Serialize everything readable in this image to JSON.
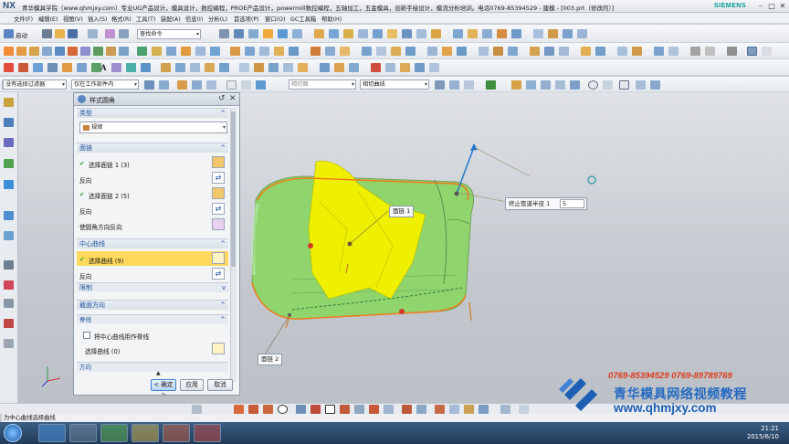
{
  "window": {
    "app_logo": "NX",
    "title": "青华模具学院（www.qhmjxy.com）专业UG产品设计，模具设计，数控编程，PROE产品设计，powermill数控编程，五轴加工，五金模具，创新手绘设计，模流分析培训。电话0769-85394529 - 建模 - [003.prt（修改的）]",
    "brand": "SIEMENS",
    "controls": [
      "–",
      "□",
      "✕"
    ]
  },
  "menubar": {
    "items": [
      "文件(F)",
      "编辑(E)",
      "视图(V)",
      "插入(S)",
      "格式(R)",
      "工具(T)",
      "装配(A)",
      "信息(I)",
      "分析(L)",
      "首选项(P)",
      "窗口(O)",
      "GC工具箱",
      "帮助(H)"
    ]
  },
  "toolbar1": {
    "start_label": "启动",
    "command_search_placeholder": "查找命令"
  },
  "selection_bar": {
    "filter_value": "没有选择过滤器",
    "scope_value": "仅在工作部件内",
    "dd3_value": "相切面",
    "dd4_value": "相切曲线"
  },
  "dialog": {
    "title": "样式圆角",
    "type_section": "类型",
    "type_value": "规律",
    "rails_section": "面链",
    "rail1_label": "选择面链 1 (3)",
    "reverse1": "反向",
    "rail2_label": "选择面链 2 (5)",
    "reverse2": "反向",
    "flip_fillet_label": "使圆角方向反向",
    "spine_section": "中心曲线",
    "spine_select_label": "选择曲线 (9)",
    "reverse3": "反向",
    "limits_label": "限制",
    "section_orient": "截面方向",
    "spine_sub": "脊线",
    "use_spine_checkbox": "将中心曲线用作脊线",
    "spine_curve_label": "选择曲线 (0)",
    "direction_label": "方向",
    "ok": "< 确定 >",
    "apply": "应用",
    "cancel": "取消"
  },
  "viewport": {
    "radius_label": "终止管道半径 1",
    "radius_value": "5",
    "tag1": "面链 1",
    "tag2": "面链 2"
  },
  "status": {
    "prompt": "为中心曲线选择曲线"
  },
  "taskbar": {
    "time": "21:21",
    "date": "2015/6/10"
  },
  "promo": {
    "phones": "0769-85394529  0769-89789769",
    "brand": "青华模具网络视频教程",
    "url": "www.qhmjxy.com"
  },
  "colors": {
    "model_green": "#8fd46c",
    "fillet_yellow": "#eef000",
    "edge_orange": "#f07a1a",
    "accent_blue": "#2469c1"
  }
}
